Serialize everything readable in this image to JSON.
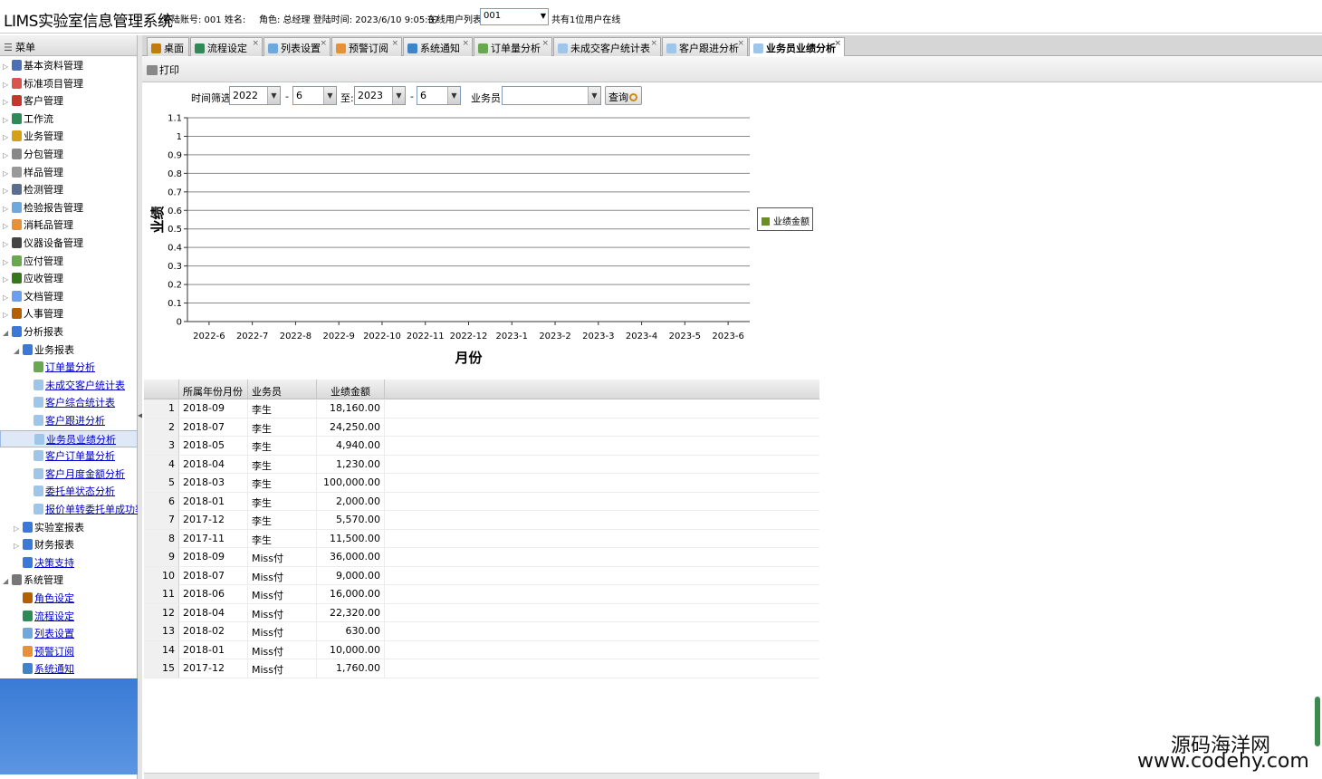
{
  "header": {
    "title": "LIMS实验室信息管理系统",
    "login_account": "登陆账号: 001 姓名:",
    "role": "角色: 总经理 登陆时间: 2023/6/10 9:05:37",
    "online_list_label": "在线用户列表:",
    "online_value": "001",
    "online_count": "共有1位用户在线"
  },
  "sidebar": {
    "title": "菜单",
    "items": [
      {
        "label": "基本资料管理",
        "color": "#4a6fb5"
      },
      {
        "label": "标准项目管理",
        "color": "#d9534f"
      },
      {
        "label": "客户管理",
        "color": "#c0392b"
      },
      {
        "label": "工作流",
        "color": "#2e8b57"
      },
      {
        "label": "业务管理",
        "color": "#d4a017"
      },
      {
        "label": "分包管理",
        "color": "#888888"
      },
      {
        "label": "样品管理",
        "color": "#999999"
      },
      {
        "label": "检测管理",
        "color": "#5a6f8f"
      },
      {
        "label": "检验报告管理",
        "color": "#6fa8dc"
      },
      {
        "label": "消耗品管理",
        "color": "#e69138"
      },
      {
        "label": "仪器设备管理",
        "color": "#444444"
      },
      {
        "label": "应付管理",
        "color": "#6aa84f"
      },
      {
        "label": "应收管理",
        "color": "#38761d"
      },
      {
        "label": "文档管理",
        "color": "#6d9eeb"
      },
      {
        "label": "人事管理",
        "color": "#b45f06"
      },
      {
        "label": "分析报表",
        "color": "#3c78d8"
      },
      {
        "label": "业务报表",
        "color": "#3c78d8"
      },
      {
        "label": "订单量分析",
        "color": "#6aa84f"
      },
      {
        "label": "未成交客户统计表",
        "color": "#9fc5e8"
      },
      {
        "label": "客户综合统计表",
        "color": "#9fc5e8"
      },
      {
        "label": "客户跟进分析",
        "color": "#9fc5e8"
      },
      {
        "label": "业务员业绩分析",
        "color": "#9fc5e8"
      },
      {
        "label": "客户订单量分析",
        "color": "#9fc5e8"
      },
      {
        "label": "客户月度金额分析",
        "color": "#9fc5e8"
      },
      {
        "label": "委托单状态分析",
        "color": "#9fc5e8"
      },
      {
        "label": "报价单转委托单成功率",
        "color": "#9fc5e8"
      },
      {
        "label": "实验室报表",
        "color": "#3c78d8"
      },
      {
        "label": "财务报表",
        "color": "#3c78d8"
      },
      {
        "label": "决策支持",
        "color": "#3c78d8"
      },
      {
        "label": "系统管理",
        "color": "#777777"
      },
      {
        "label": "角色设定",
        "color": "#b45f06"
      },
      {
        "label": "流程设定",
        "color": "#2e8b57"
      },
      {
        "label": "列表设置",
        "color": "#6fa8dc"
      },
      {
        "label": "预警订阅",
        "color": "#e69138"
      },
      {
        "label": "系统通知",
        "color": "#3d85c6"
      }
    ]
  },
  "tabs": [
    {
      "label": "桌面",
      "color": "#c27c0e"
    },
    {
      "label": "流程设定",
      "color": "#2e8b57"
    },
    {
      "label": "列表设置",
      "color": "#6fa8dc"
    },
    {
      "label": "预警订阅",
      "color": "#e69138"
    },
    {
      "label": "系统通知",
      "color": "#3d85c6"
    },
    {
      "label": "订单量分析",
      "color": "#6aa84f"
    },
    {
      "label": "未成交客户统计表",
      "color": "#9fc5e8"
    },
    {
      "label": "客户跟进分析",
      "color": "#9fc5e8"
    },
    {
      "label": "业务员业绩分析",
      "color": "#9fc5e8"
    }
  ],
  "toolbar": {
    "print_label": "打印"
  },
  "filter": {
    "time_label": "时间筛选:",
    "from_year": "2022",
    "from_month": "6",
    "to_label": "至:",
    "to_year": "2023",
    "to_month": "6",
    "dash": "-",
    "salesperson_label": "业务员:",
    "salesperson_value": "",
    "query_label": "查询"
  },
  "chart_data": {
    "type": "bar",
    "categories": [
      "2022-6",
      "2022-7",
      "2022-8",
      "2022-9",
      "2022-10",
      "2022-11",
      "2022-12",
      "2023-1",
      "2023-2",
      "2023-3",
      "2023-4",
      "2023-5",
      "2023-6"
    ],
    "series": [
      {
        "name": "业绩金额",
        "values": [
          0,
          0,
          0,
          0,
          0,
          0,
          0,
          0,
          0,
          0,
          0,
          0,
          0
        ],
        "color": "#6b8e23"
      }
    ],
    "xlabel": "月份",
    "ylabel": "业绩",
    "ylim": [
      0,
      1.1
    ],
    "yticks": [
      "0",
      "0.1",
      "0.2",
      "0.3",
      "0.4",
      "0.5",
      "0.6",
      "0.7",
      "0.8",
      "0.9",
      "1",
      "1.1"
    ],
    "grid": true,
    "legend": "right"
  },
  "table": {
    "columns": [
      "所属年份月份",
      "业务员",
      "业绩金额"
    ],
    "rows": [
      [
        "1",
        "2018-09",
        "李生",
        "18,160.00"
      ],
      [
        "2",
        "2018-07",
        "李生",
        "24,250.00"
      ],
      [
        "3",
        "2018-05",
        "李生",
        "4,940.00"
      ],
      [
        "4",
        "2018-04",
        "李生",
        "1,230.00"
      ],
      [
        "5",
        "2018-03",
        "李生",
        "100,000.00"
      ],
      [
        "6",
        "2018-01",
        "李生",
        "2,000.00"
      ],
      [
        "7",
        "2017-12",
        "李生",
        "5,570.00"
      ],
      [
        "8",
        "2017-11",
        "李生",
        "11,500.00"
      ],
      [
        "9",
        "2018-09",
        "Miss付",
        "36,000.00"
      ],
      [
        "10",
        "2018-07",
        "Miss付",
        "9,000.00"
      ],
      [
        "11",
        "2018-06",
        "Miss付",
        "16,000.00"
      ],
      [
        "12",
        "2018-04",
        "Miss付",
        "22,320.00"
      ],
      [
        "13",
        "2018-02",
        "Miss付",
        "630.00"
      ],
      [
        "14",
        "2018-01",
        "Miss付",
        "10,000.00"
      ],
      [
        "15",
        "2017-12",
        "Miss付",
        "1,760.00"
      ]
    ]
  },
  "watermark": {
    "line1": "源码海洋网",
    "line2": "www.codehy.com"
  }
}
